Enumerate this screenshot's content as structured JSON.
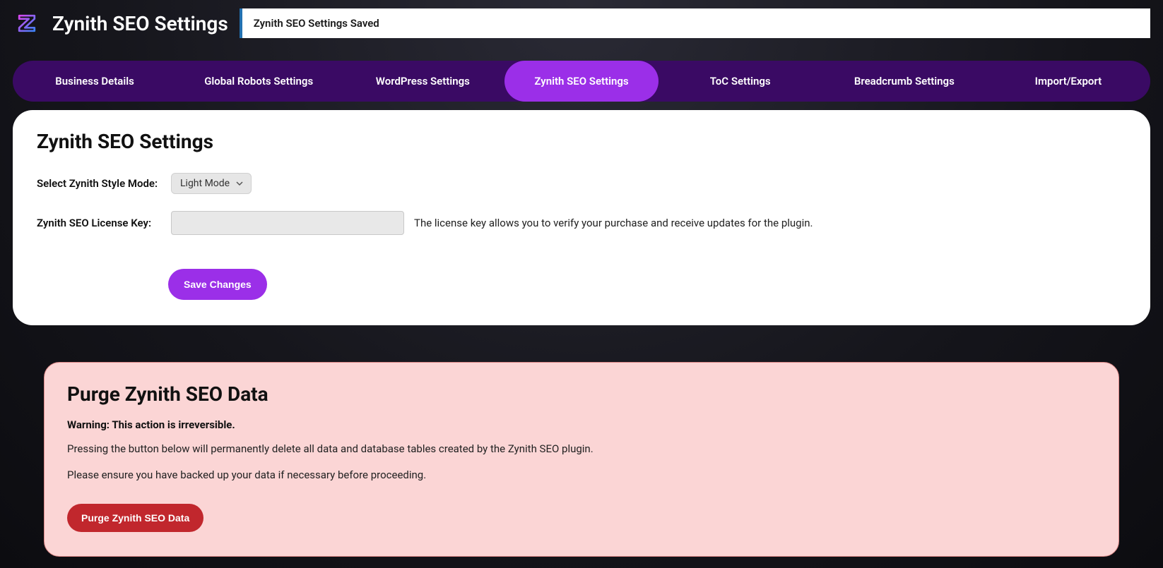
{
  "header": {
    "title": "Zynith SEO Settings",
    "notification": "Zynith SEO Settings Saved"
  },
  "tabs": [
    {
      "label": "Business Details"
    },
    {
      "label": "Global Robots Settings"
    },
    {
      "label": "WordPress Settings"
    },
    {
      "label": "Zynith SEO Settings"
    },
    {
      "label": "ToC Settings"
    },
    {
      "label": "Breadcrumb Settings"
    },
    {
      "label": "Import/Export"
    }
  ],
  "settings": {
    "title": "Zynith SEO Settings",
    "style_mode_label": "Select Zynith Style Mode:",
    "style_mode_value": "Light Mode",
    "license_key_label": "Zynith SEO License Key:",
    "license_key_help": "The license key allows you to verify your purchase and receive updates for the plugin.",
    "save_button": "Save Changes"
  },
  "purge": {
    "title": "Purge Zynith SEO Data",
    "warning": "Warning: This action is irreversible.",
    "text1": "Pressing the button below will permanently delete all data and database tables created by the Zynith SEO plugin.",
    "text2": "Please ensure you have backed up your data if necessary before proceeding.",
    "button": "Purge Zynith SEO Data"
  }
}
